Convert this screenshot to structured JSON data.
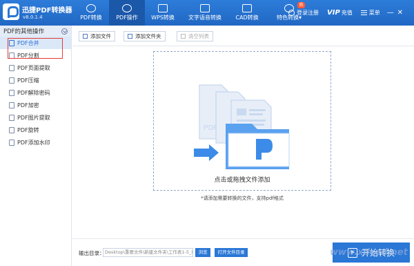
{
  "app": {
    "title": "迅捷PDF转换器",
    "version": "v8.0.1.4"
  },
  "nav": {
    "items": [
      {
        "label": "PDF转换",
        "icon": "refresh-icon"
      },
      {
        "label": "PDF操作",
        "icon": "settings-icon",
        "active": true
      },
      {
        "label": "WPS转换",
        "icon": "document-icon"
      },
      {
        "label": "文字语音转换",
        "icon": "audio-icon"
      },
      {
        "label": "CAD转换",
        "icon": "cad-icon"
      },
      {
        "label": "特色转换▾",
        "icon": "star-icon",
        "badge": "热"
      }
    ],
    "login": "登录注册",
    "vip": "VIP",
    "recharge": "充值",
    "menu": "菜单",
    "minimize": "—",
    "close": "✕"
  },
  "sidebar": {
    "header": "PDF的其他操作",
    "items": [
      {
        "label": "PDF合并",
        "active": true
      },
      {
        "label": "PDF分割"
      },
      {
        "label": "PDF页面提取"
      },
      {
        "label": "PDF压缩"
      },
      {
        "label": "PDF解除密码"
      },
      {
        "label": "PDF加密"
      },
      {
        "label": "PDF图片提取"
      },
      {
        "label": "PDF旋转"
      },
      {
        "label": "PDF添加水印"
      }
    ]
  },
  "toolbar": {
    "add_file": "添加文件",
    "add_folder": "添加文件夹",
    "clear_list": "清空列表"
  },
  "dropzone": {
    "text": "点击或拖拽文件添加",
    "hint": "*请添加需要转换的文件，支持pdf格式"
  },
  "bottom": {
    "output_label": "输出目录：",
    "output_path": "Desktop\\重要文件\\新建文件夹\\工作表1-5_IMG",
    "browse": "浏览",
    "open_dir": "打开文件目录",
    "start": "开始转换"
  },
  "watermark": "www.xdcad.net",
  "colors": {
    "brand": "#2a77d6",
    "topbar": "#2168c4",
    "active_nav": "#1b58aa",
    "highlight_frame": "#e53935"
  }
}
